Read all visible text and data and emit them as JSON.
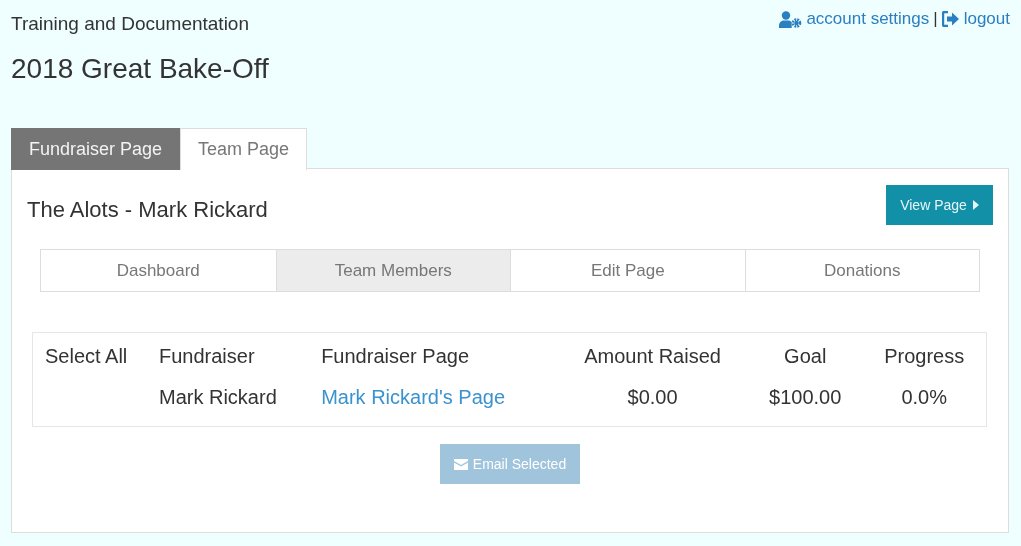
{
  "header": {
    "org": "Training and Documentation",
    "title": "2018 Great Bake-Off"
  },
  "top_links": [
    {
      "kind": "account",
      "label": "account settings"
    },
    {
      "kind": "logout",
      "label": "logout"
    }
  ],
  "top_links_separator": "|",
  "tabs": [
    {
      "label": "Fundraiser Page",
      "selected": false
    },
    {
      "label": "Team Page",
      "selected": true
    }
  ],
  "panel": {
    "title": "The Alots - Mark Rickard",
    "view_button": "View Page",
    "subtabs": [
      {
        "label": "Dashboard",
        "selected": false
      },
      {
        "label": "Team Members",
        "selected": true
      },
      {
        "label": "Edit Page",
        "selected": false
      },
      {
        "label": "Donations",
        "selected": false
      }
    ],
    "table": {
      "columns": [
        "Select All",
        "Fundraiser",
        "Fundraiser Page",
        "Amount Raised",
        "Goal",
        "Progress"
      ],
      "rows": [
        {
          "fundraiser": "Mark Rickard",
          "page_link": "Mark Rickard's Page",
          "amount_raised": "$0.00",
          "goal": "$100.00",
          "progress": "0.0%"
        }
      ]
    },
    "email_button": {
      "label": "Email Selected",
      "disabled": true
    }
  }
}
